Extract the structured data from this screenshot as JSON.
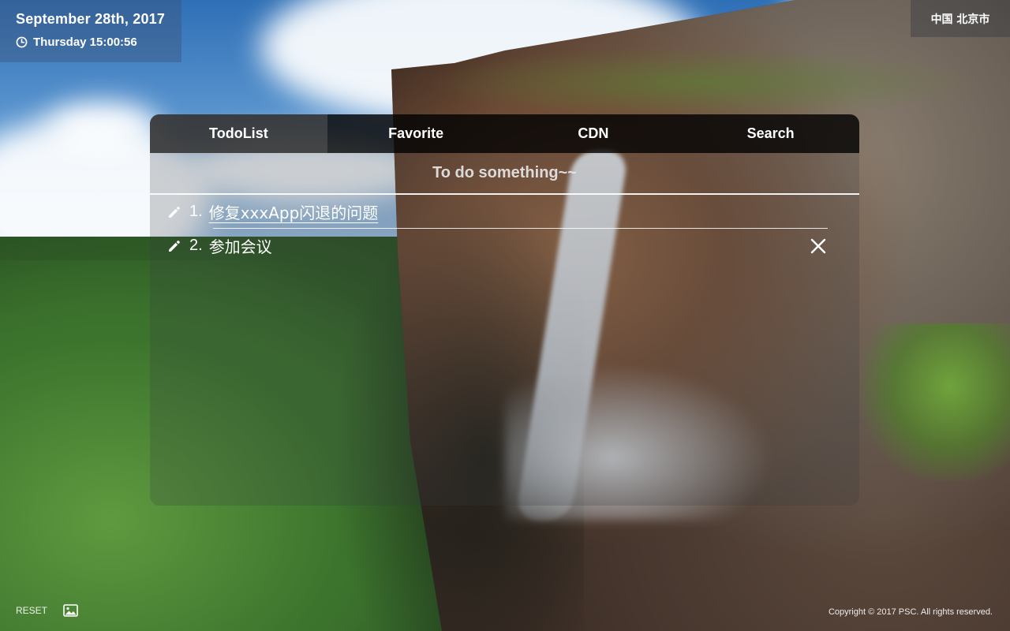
{
  "header": {
    "date": "September 28th, 2017",
    "time": "Thursday 15:00:56",
    "location": "中国 北京市"
  },
  "icons": {
    "clock": "clock-icon",
    "edit": "pencil-icon",
    "delete": "close-icon",
    "background": "image-icon"
  },
  "tabs": [
    {
      "label": "TodoList",
      "active": true
    },
    {
      "label": "Favorite",
      "active": false
    },
    {
      "label": "CDN",
      "active": false
    },
    {
      "label": "Search",
      "active": false
    }
  ],
  "todo": {
    "heading": "To do something~~",
    "items": [
      {
        "number": "1.",
        "text": "修复xxxApp闪退的问题"
      },
      {
        "number": "2.",
        "text": "参加会议"
      }
    ]
  },
  "footer": {
    "reset_label": "RESET",
    "copyright": "Copyright © 2017 PSC. All rights reserved."
  }
}
